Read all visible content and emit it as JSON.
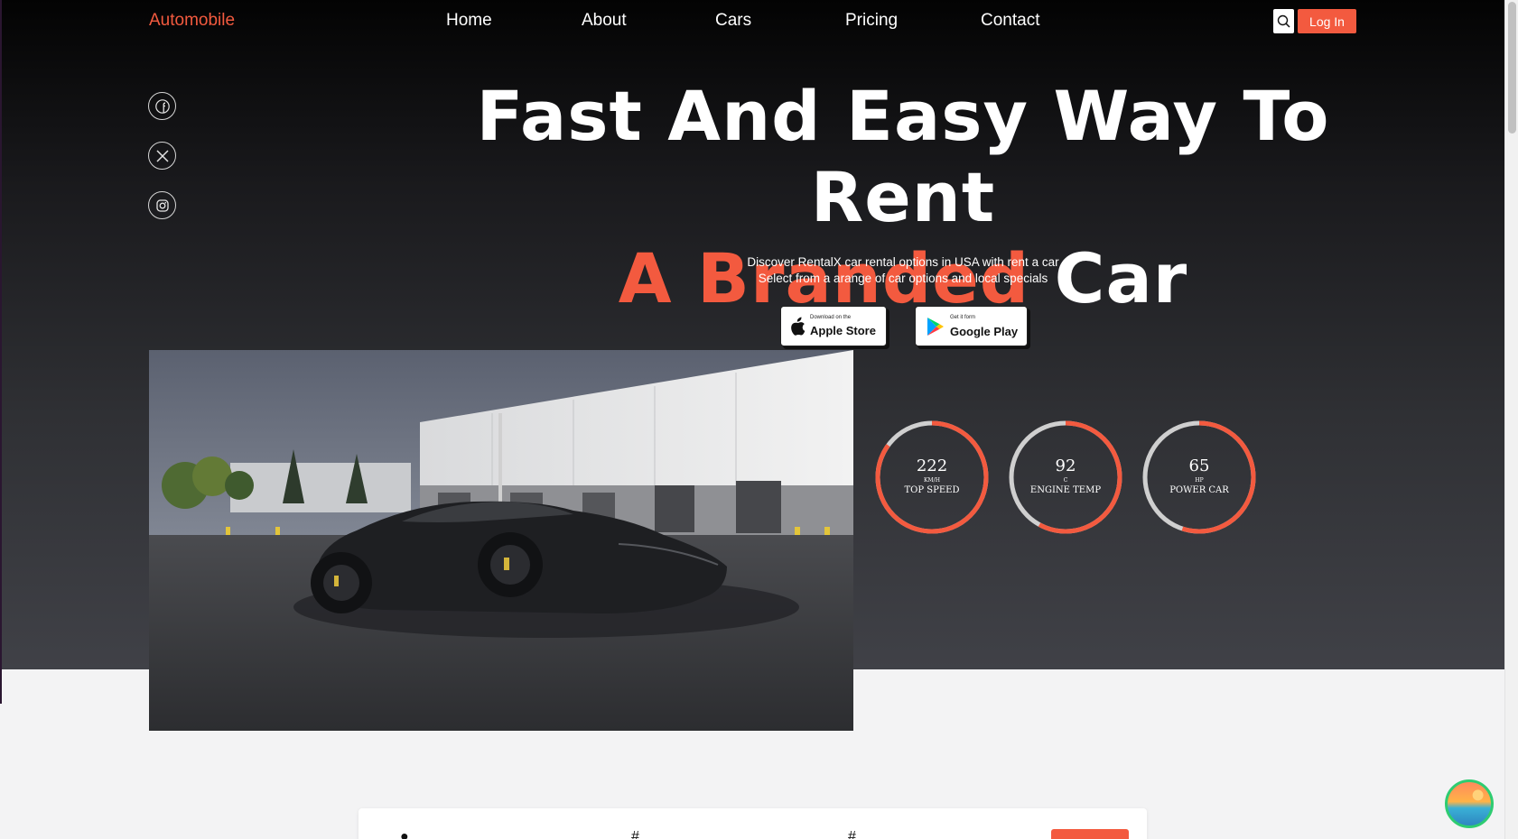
{
  "nav": {
    "brand": "Automobile",
    "links": [
      "Home",
      "About",
      "Cars",
      "Pricing",
      "Contact"
    ],
    "login_label": "Log In"
  },
  "social": [
    "facebook-icon",
    "x-twitter-icon",
    "instagram-icon"
  ],
  "hero": {
    "title_line1": "Fast And Easy Way To Rent",
    "title_accent": "A Branded",
    "title_rest": "Car",
    "subtitle_line1": "Discover RentalX car rental options in USA with rent a car",
    "subtitle_line2": "Select from a arange of car options and local specials"
  },
  "stores": {
    "apple_small": "Download on the",
    "apple_big": "Apple Store",
    "google_small": "Get it form",
    "google_big": "Google Play"
  },
  "stats": [
    {
      "value": "222",
      "unit": "KM/H",
      "label": "TOP SPEED",
      "fill": 0.85
    },
    {
      "value": "92",
      "unit": "C",
      "label": "ENGINE TEMP",
      "fill": 0.58
    },
    {
      "value": "65",
      "unit": "HP",
      "label": "POWER CAR",
      "fill": 0.55
    }
  ],
  "colors": {
    "accent": "#f35a3f",
    "track": "#cfcfcf",
    "dark": "#030303"
  }
}
